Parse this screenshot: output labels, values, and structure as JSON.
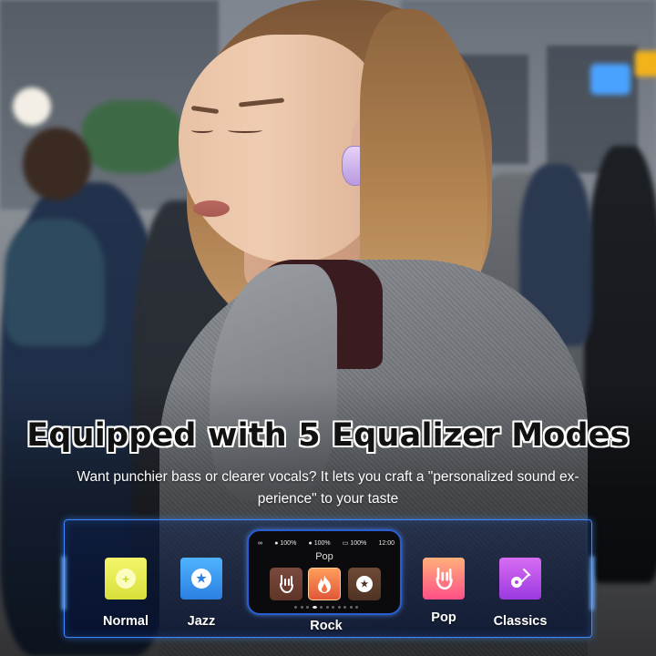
{
  "headline": "Equipped with 5 Equalizer Modes",
  "subtext": "Want punchier bass or clearer vocals? It lets you craft a \"personalized sound ex-perience\" to your taste",
  "eq_modes": [
    {
      "label": "Normal",
      "icon": "plus-icon",
      "color": "#e8ec50"
    },
    {
      "label": "Jazz",
      "icon": "star-icon",
      "color": "#3a9af0"
    },
    {
      "label": "Rock",
      "icon": "rock-hand-icon",
      "color": "#ff7a4a",
      "selected": true
    },
    {
      "label": "Pop",
      "icon": "rock-hand-icon",
      "color": "#ff6a7f"
    },
    {
      "label": "Classics",
      "icon": "guitar-icon",
      "color": "#c055ea"
    }
  ],
  "phone_screen": {
    "status_left": "∞",
    "battery_1": "100%",
    "battery_2": "100%",
    "battery_3": "100%",
    "time": "12:00",
    "title": "Pop",
    "tiles": [
      "rock-hand-icon",
      "flame-icon",
      "star-icon"
    ]
  },
  "colors": {
    "panel_border": "#3f86ff",
    "earbud": "#d8c2f2"
  }
}
